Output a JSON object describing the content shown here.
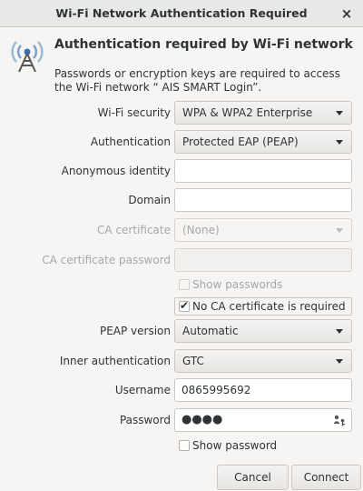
{
  "window": {
    "title": "Wi-Fi Network Authentication Required",
    "close_symbol": "×"
  },
  "header": {
    "icon": "wifi-tower-icon",
    "heading": "Authentication required by Wi-Fi network",
    "description": "Passwords or encryption keys are required to access the Wi-Fi network “ AIS SMART Login”."
  },
  "form": {
    "wifi_security": {
      "label": "Wi-Fi security",
      "value": "WPA & WPA2 Enterprise"
    },
    "authentication": {
      "label": "Authentication",
      "value": "Protected EAP (PEAP)"
    },
    "anonymous_identity": {
      "label": "Anonymous identity",
      "value": ""
    },
    "domain": {
      "label": "Domain",
      "value": ""
    },
    "ca_certificate": {
      "label": "CA certificate",
      "value": "(None)",
      "disabled": true
    },
    "ca_certificate_password": {
      "label": "CA certificate password",
      "value": "",
      "disabled": true
    },
    "show_passwords": {
      "label": "Show passwords",
      "checked": false,
      "disabled": true
    },
    "no_ca_required": {
      "label": "No CA certificate is required",
      "checked": true
    },
    "peap_version": {
      "label": "PEAP version",
      "value": "Automatic"
    },
    "inner_authentication": {
      "label": "Inner authentication",
      "value": "GTC"
    },
    "username": {
      "label": "Username",
      "value": "0865995692"
    },
    "password": {
      "label": "Password",
      "value": "●●●●",
      "icon": "user-key-icon"
    },
    "show_password": {
      "label": "Show password",
      "checked": false
    }
  },
  "buttons": {
    "cancel": "Cancel",
    "connect": "Connect"
  }
}
